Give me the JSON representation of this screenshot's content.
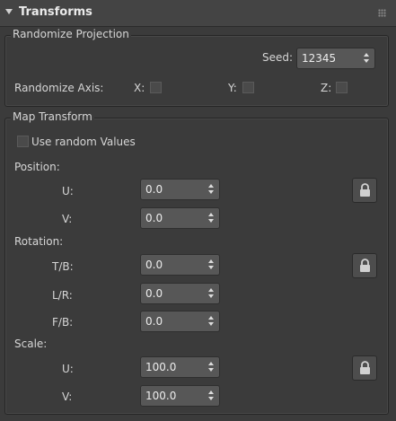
{
  "rollout": {
    "title": "Transforms"
  },
  "randomize_projection": {
    "title": "Randomize Projection",
    "seed_label": "Seed:",
    "seed_value": "12345",
    "axis_label": "Randomize Axis:",
    "axes": {
      "x": "X:",
      "y": "Y:",
      "z": "Z:"
    },
    "axis_checked": {
      "x": false,
      "y": false,
      "z": false
    }
  },
  "map_transform": {
    "title": "Map Transform",
    "use_random_label": "Use random Values",
    "use_random_checked": false,
    "position": {
      "label": "Position:",
      "u_label": "U:",
      "u_value": "0.0",
      "v_label": "V:",
      "v_value": "0.0"
    },
    "rotation": {
      "label": "Rotation:",
      "tb_label": "T/B:",
      "tb_value": "0.0",
      "lr_label": "L/R:",
      "lr_value": "0.0",
      "fb_label": "F/B:",
      "fb_value": "0.0"
    },
    "scale": {
      "label": "Scale:",
      "u_label": "U:",
      "u_value": "100.0",
      "v_label": "V:",
      "v_value": "100.0"
    }
  },
  "colors": {
    "panel_bg": "#3b3b3b",
    "header_bg": "#444444",
    "spinner_bg": "#575757",
    "text": "#d6d6d6"
  }
}
